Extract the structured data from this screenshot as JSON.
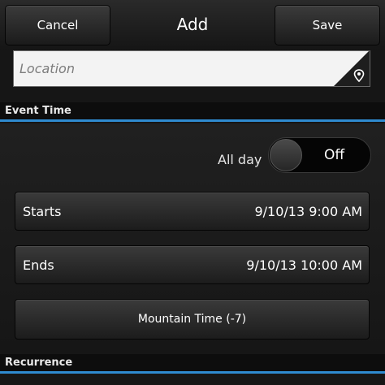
{
  "header": {
    "cancel_label": "Cancel",
    "title": "Add",
    "save_label": "Save"
  },
  "location": {
    "placeholder": "Location",
    "icon": "location-pin-icon"
  },
  "sections": {
    "event_time": "Event Time",
    "recurrence": "Recurrence"
  },
  "all_day": {
    "label": "All day",
    "toggle_text": "Off",
    "value": false
  },
  "starts": {
    "label": "Starts",
    "value": "9/10/13 9:00 AM"
  },
  "ends": {
    "label": "Ends",
    "value": "9/10/13 10:00 AM"
  },
  "timezone": {
    "label": "Mountain Time (-7)"
  },
  "colors": {
    "accent": "#2f8bd0",
    "background": "#161616"
  }
}
